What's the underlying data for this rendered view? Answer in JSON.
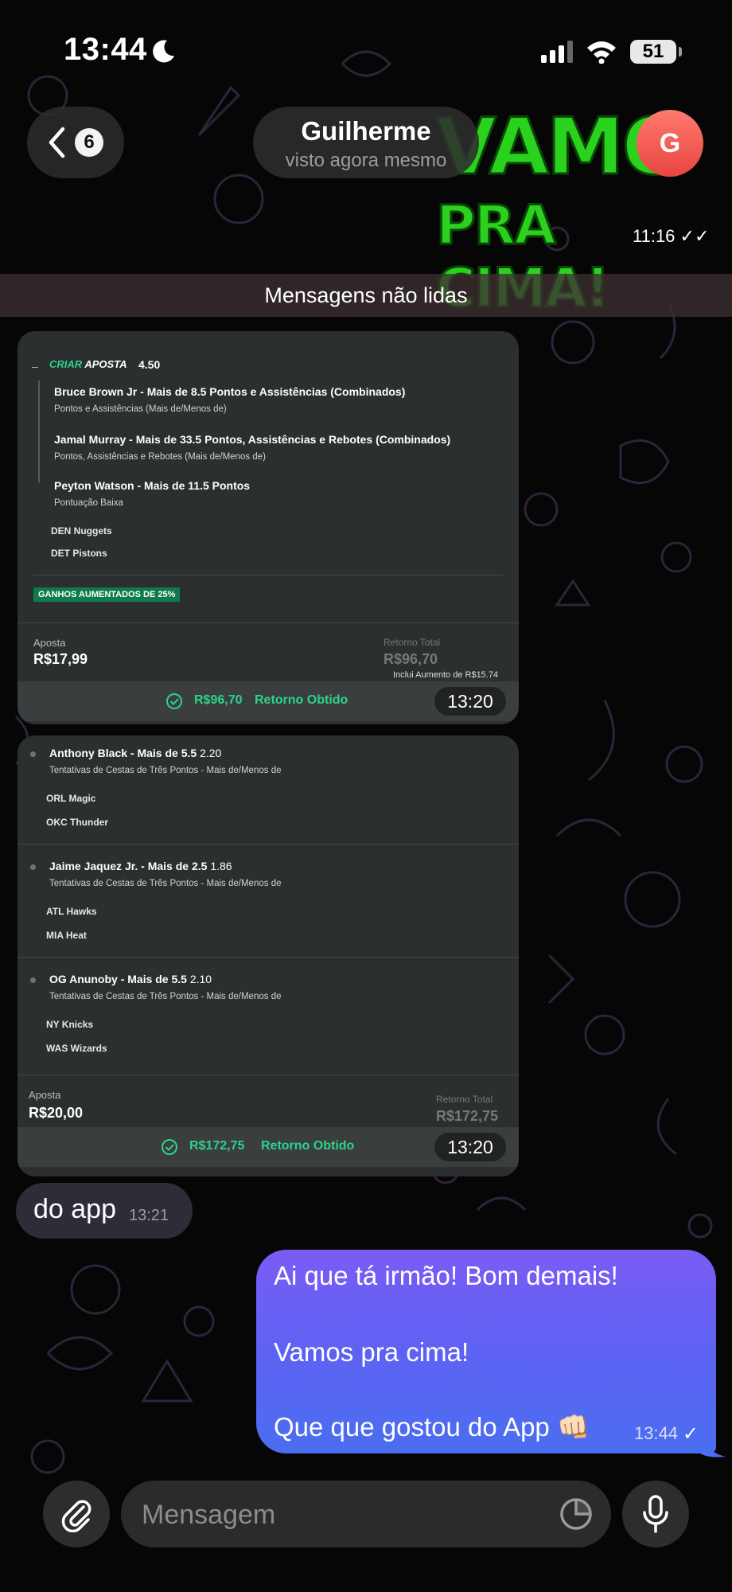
{
  "status_bar": {
    "time": "13:44",
    "battery": "51"
  },
  "header": {
    "back_badge": "6",
    "contact_name": "Guilherme",
    "contact_status": "visto agora mesmo",
    "avatar_letter": "G",
    "avatar_color": "#e8453f"
  },
  "sticker": {
    "line1": "VAMO",
    "line2": "PRA CIMA!",
    "time": "11:16"
  },
  "unread_label": "Mensagens não lidas",
  "card1": {
    "header_collapse": "–",
    "header_criar": "CRIAR",
    "header_aposta": "APOSTA",
    "odds": "4.50",
    "legs": [
      {
        "title": "Bruce Brown Jr - Mais de 8.5 Pontos e Assistências (Combinados)",
        "market": "Pontos e Assistências (Mais de/Menos de)"
      },
      {
        "title": "Jamal Murray - Mais de 33.5 Pontos, Assistências e Rebotes (Combinados)",
        "market": "Pontos, Assistências e Rebotes (Mais de/Menos de)"
      },
      {
        "title": "Peyton Watson - Mais de 11.5 Pontos",
        "market": "Pontuação Baixa"
      }
    ],
    "teams": [
      "DEN Nuggets",
      "DET Pistons"
    ],
    "promo": "GANHOS AUMENTADOS DE 25%",
    "stake_label": "Aposta",
    "stake": "R$17,99",
    "return_label": "Retorno Total",
    "return_value": "R$96,70",
    "boost_note": "Inclui Aumento de R$15.74",
    "cashout_amount": "R$96,70",
    "cashout_label": "Retorno Obtido",
    "time": "13:20"
  },
  "card2": {
    "legs": [
      {
        "title": "Anthony Black - Mais de 5.5",
        "odds": "2.20",
        "market": "Tentativas de Cestas de Três Pontos - Mais de/Menos de",
        "teams": [
          "ORL Magic",
          "OKC Thunder"
        ]
      },
      {
        "title": "Jaime Jaquez Jr. - Mais de 2.5",
        "odds": "1.86",
        "market": "Tentativas de Cestas de Três Pontos - Mais de/Menos de",
        "teams": [
          "ATL Hawks",
          "MIA Heat"
        ]
      },
      {
        "title": "OG Anunoby - Mais de 5.5",
        "odds": "2.10",
        "market": "Tentativas de Cestas de Três Pontos - Mais de/Menos de",
        "teams": [
          "NY Knicks",
          "WAS Wizards"
        ]
      }
    ],
    "stake_label": "Aposta",
    "stake": "R$20,00",
    "return_label": "Retorno Total",
    "return_value": "R$172,75",
    "cashout_amount": "R$172,75",
    "cashout_label": "Retorno Obtido",
    "time": "13:20"
  },
  "incoming_message": {
    "text": "do app",
    "time": "13:21"
  },
  "outgoing_message": {
    "line1": "Ai que tá irmão! Bom demais!",
    "line2": "Vamos pra cima!",
    "line3": "Que que gostou do App 👊🏻",
    "time": "13:44"
  },
  "composer": {
    "placeholder": "Mensagem"
  },
  "colors": {
    "accent_green": "#2bd48b",
    "outgoing_bubble": "#5b63f3"
  }
}
